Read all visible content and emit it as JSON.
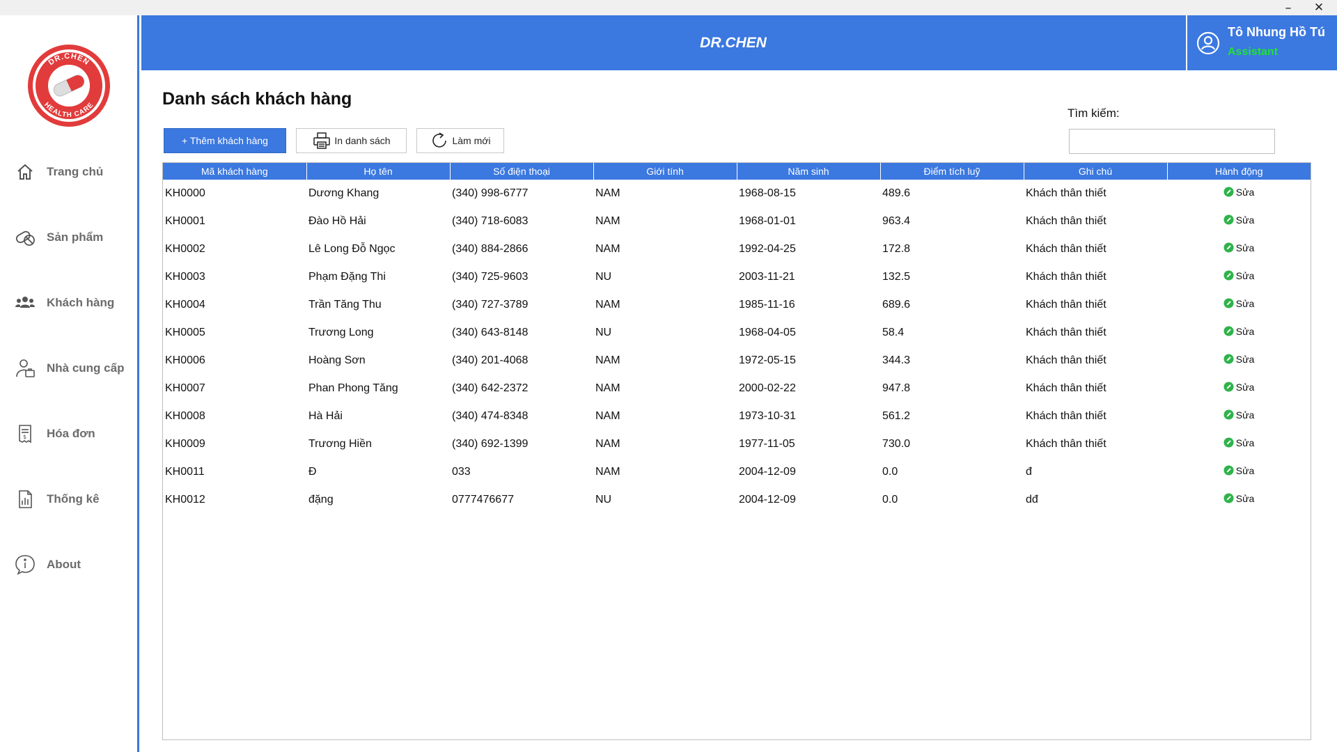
{
  "window": {
    "minimize_glyph": "–",
    "close_glyph": "✕"
  },
  "sidebar": {
    "logo_text_top": "DR.CHEN",
    "logo_text_bottom": "HEALTH CARE",
    "items": [
      {
        "label": "Trang chủ",
        "icon": "home-icon"
      },
      {
        "label": "Sản phẩm",
        "icon": "pill-icon"
      },
      {
        "label": "Khách hàng",
        "icon": "users-icon"
      },
      {
        "label": "Nhà cung cấp",
        "icon": "supplier-icon"
      },
      {
        "label": "Hóa đơn",
        "icon": "invoice-icon"
      },
      {
        "label": "Thống kê",
        "icon": "report-icon"
      },
      {
        "label": "About",
        "icon": "info-icon"
      }
    ]
  },
  "header": {
    "title": "DR.CHEN"
  },
  "user": {
    "name": "Tô Nhung Hồ Tú",
    "role": "Assistant"
  },
  "main": {
    "title": "Danh sách khách hàng",
    "search": {
      "label": "Tìm kiếm:",
      "value": "",
      "placeholder": ""
    },
    "buttons": {
      "add": "+ Thêm khách hàng",
      "print": "In danh sách",
      "refresh": "Làm mới"
    }
  },
  "table": {
    "columns": [
      "Mã khách hàng",
      "Họ tên",
      "Số điện thoại",
      "Giới tính",
      "Năm sinh",
      "Điểm tích luỹ",
      "Ghi chú",
      "Hành động"
    ],
    "action_label": "Sửa",
    "rows": [
      [
        "KH0000",
        "Dương Khang",
        "(340) 998-6777",
        "NAM",
        "1968-08-15",
        "489.6",
        "Khách thân thiết"
      ],
      [
        "KH0001",
        "Đào Hồ Hải",
        "(340) 718-6083",
        "NAM",
        "1968-01-01",
        "963.4",
        "Khách thân thiết"
      ],
      [
        "KH0002",
        "Lê Long Đỗ Ngọc",
        "(340) 884-2866",
        "NAM",
        "1992-04-25",
        "172.8",
        "Khách thân thiết"
      ],
      [
        "KH0003",
        "Phạm Đặng Thi",
        "(340) 725-9603",
        "NU",
        "2003-11-21",
        "132.5",
        "Khách thân thiết"
      ],
      [
        "KH0004",
        "Trần Tăng Thu",
        "(340) 727-3789",
        "NAM",
        "1985-11-16",
        "689.6",
        "Khách thân thiết"
      ],
      [
        "KH0005",
        "Trương Long",
        "(340) 643-8148",
        "NU",
        "1968-04-05",
        "58.4",
        "Khách thân thiết"
      ],
      [
        "KH0006",
        "Hoàng Sơn",
        "(340) 201-4068",
        "NAM",
        "1972-05-15",
        "344.3",
        "Khách thân thiết"
      ],
      [
        "KH0007",
        "Phan Phong Tăng",
        "(340) 642-2372",
        "NAM",
        "2000-02-22",
        "947.8",
        "Khách thân thiết"
      ],
      [
        "KH0008",
        "Hà Hải",
        "(340) 474-8348",
        "NAM",
        "1973-10-31",
        "561.2",
        "Khách thân thiết"
      ],
      [
        "KH0009",
        "Trương Hiền",
        "(340) 692-1399",
        "NAM",
        "1977-11-05",
        "730.0",
        "Khách thân thiết"
      ],
      [
        "KH0011",
        "Đ",
        "033",
        "NAM",
        "2004-12-09",
        "0.0",
        "đ"
      ],
      [
        "KH0012",
        "đặng",
        "0777476677",
        "NU",
        "2004-12-09",
        "0.0",
        "dđ"
      ]
    ]
  },
  "colors": {
    "primary": "#3b78e0",
    "role_green": "#22e03a",
    "edit_green": "#2fb34a",
    "logo_red": "#e23b3b"
  }
}
